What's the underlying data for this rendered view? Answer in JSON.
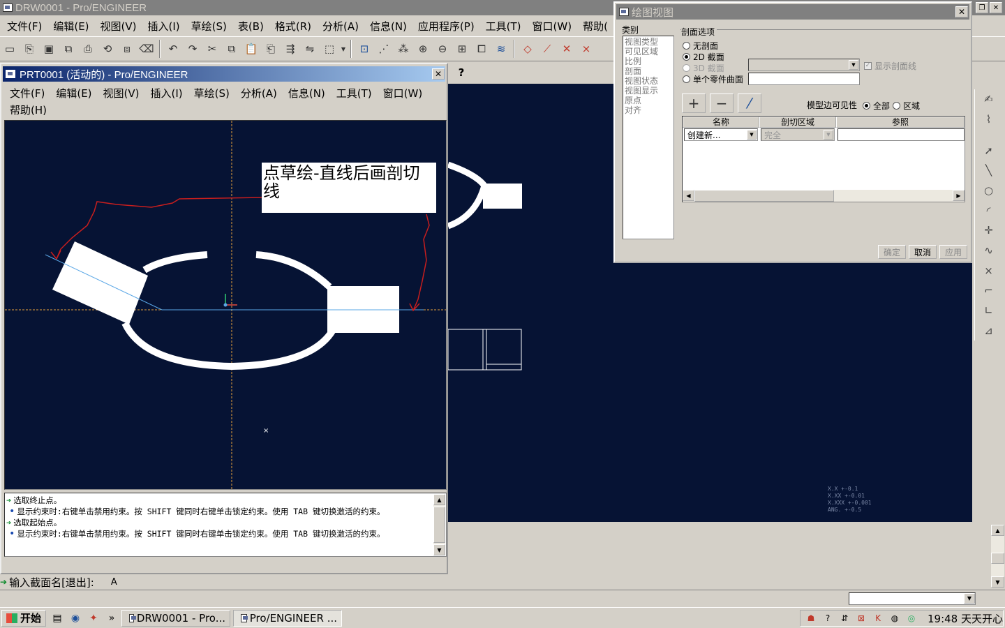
{
  "main_window": {
    "title": "DRW0001 - Pro/ENGINEER",
    "menu": [
      "文件(F)",
      "编辑(E)",
      "视图(V)",
      "插入(I)",
      "草绘(S)",
      "表(B)",
      "格式(R)",
      "分析(A)",
      "信息(N)",
      "应用程序(P)",
      "工具(T)",
      "窗口(W)",
      "帮助("
    ],
    "whats_this": "?"
  },
  "prt_window": {
    "title": "PRT0001 (活动的) - Pro/ENGINEER",
    "menu_row1": [
      "文件(F)",
      "编辑(E)",
      "视图(V)",
      "插入(I)",
      "草绘(S)",
      "分析(A)",
      "信息(N)",
      "工具(T)",
      "窗口(W)"
    ],
    "menu_row2": [
      "帮助(H)"
    ],
    "note": "点草绘-直线后画剖切线",
    "messages": [
      {
        "kind": "prompt",
        "text": "选取终止点。"
      },
      {
        "kind": "info",
        "text": "显示约束时:右键单击禁用约束。按 SHIFT 键同时右键单击锁定约束。使用 TAB 键切换激活的约束。"
      },
      {
        "kind": "prompt",
        "text": "选取起始点。"
      },
      {
        "kind": "info",
        "text": "显示约束时:右键单击禁用约束。按 SHIFT 键同时右键单击锁定约束。使用 TAB 键切换激活的约束。"
      }
    ]
  },
  "command_line": {
    "prompt": "输入截面名[退出]:",
    "value": "A"
  },
  "dialog": {
    "title": "绘图视图",
    "category_label": "类别",
    "categories": [
      "视图类型",
      "可见区域",
      "比例",
      "剖面",
      "视图状态",
      "视图显示",
      "原点",
      "对齐"
    ],
    "section_group": "剖面选项",
    "options": {
      "no_section": "无剖面",
      "section_2d": "2D 截面",
      "section_3d": "3D 截面",
      "single_surface": "单个零件曲面"
    },
    "show_xhatch": "显示剖面线",
    "model_edge_visibility": "模型边可见性",
    "vis_all": "全部",
    "vis_area": "区域",
    "table_headers": [
      "名称",
      "剖切区域",
      "参照"
    ],
    "row_name": "创建新...",
    "row_area": "完全",
    "buttons": {
      "ok": "确定",
      "cancel": "取消",
      "apply": "应用"
    },
    "plus": "+",
    "minus": "−",
    "flip": "⁄"
  },
  "tolerance_note": [
    "X.X   +-0.1",
    "X.XX  +-0.01",
    "X.XXX +-0.001",
    "ANG.  +-0.5"
  ],
  "taskbar": {
    "start": "开始",
    "tasks": [
      "DRW0001 - Pro...",
      "Pro/ENGINEER ..."
    ],
    "clock": "19:48 天天开心"
  },
  "colors": {
    "canvas": "#061334",
    "active_title": "#0a246a",
    "sketch_white": "#ffffff",
    "annotation_red": "#c81e1e",
    "section_line": "#5aa7e6",
    "axis_orange": "#e6a23c"
  }
}
